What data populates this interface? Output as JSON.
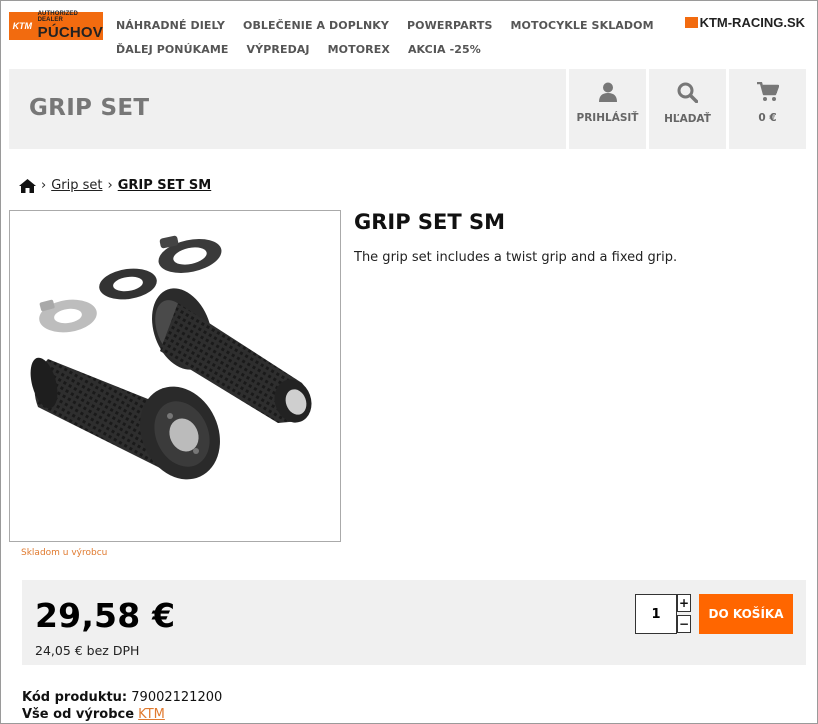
{
  "brand": {
    "logo_small": "AUTHORIZED DEALER",
    "logo_big": "PÚCHOV",
    "logo_mark": "KTM",
    "site_name": "KTM-RACING.SK",
    "accent": "#f26b0f"
  },
  "nav": {
    "row1": [
      "NÁHRADNÉ DIELY",
      "OBLEČENIE A DOPLNKY",
      "POWERPARTS",
      "MOTOCYKLE SKLADOM"
    ],
    "row2": [
      "ĎALEJ PONÚKAME",
      "VÝPREDAJ",
      "MOTOREX",
      "AKCIA -25%"
    ]
  },
  "header": {
    "title": "GRIP SET",
    "login_label": "PRIHLÁSIŤ",
    "search_label": "HĽADAŤ",
    "cart_label": "0 €"
  },
  "breadcrumb": {
    "parent": "Grip set",
    "current": "GRIP SET SM"
  },
  "product": {
    "title": "GRIP SET SM",
    "description": "The grip set includes a twist grip and a fixed grip.",
    "stock": "Skladom u výrobcu",
    "price": "29,58 €",
    "price_net": "24,05 € bez DPH",
    "quantity": "1",
    "add_to_cart": "DO KOŠÍKA",
    "code_label": "Kód produktu:",
    "code_value": "79002121200",
    "manufacturer_label": "Vše od výrobce",
    "manufacturer_link": "KTM"
  },
  "icons": {
    "login": "user-icon",
    "search": "search-icon",
    "cart": "cart-icon",
    "home": "home-icon"
  }
}
